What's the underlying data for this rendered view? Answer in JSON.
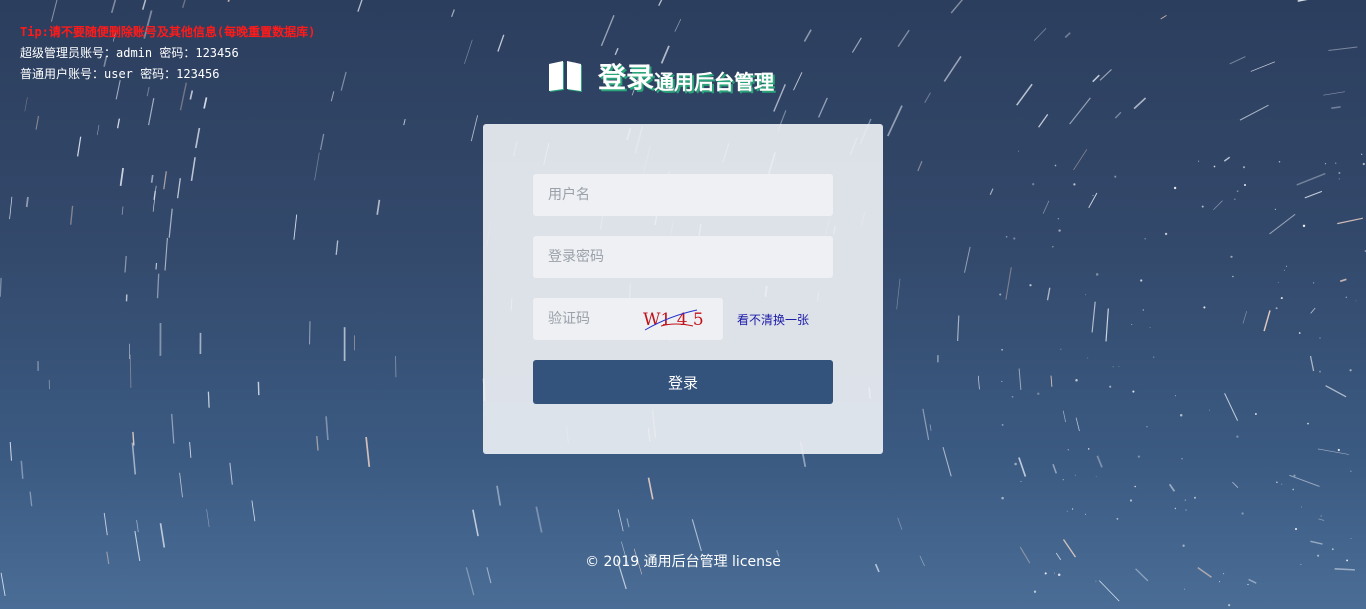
{
  "tips": {
    "warning": "Tip:请不要随便删除账号及其他信息(每晚重置数据库)",
    "admin_account": "超级管理员账号：admin 密码：123456",
    "user_account": "普通用户账号：user 密码：123456"
  },
  "brand": {
    "icon": "open-book-icon",
    "title_main": "登录",
    "title_sub": "通用后台管理",
    "shadow_color": "#2aa57a"
  },
  "login_form": {
    "username_placeholder": "用户名",
    "username_value": "",
    "password_placeholder": "登录密码",
    "password_value": "",
    "captcha_placeholder": "验证码",
    "captcha_value": "",
    "captcha_image_text": "W1 4 5",
    "refresh_captcha_label": "看不清换一张",
    "submit_label": "登录"
  },
  "footer": {
    "copyright": "© 2019 通用后台管理 license"
  },
  "colors": {
    "background": "#33496b",
    "button": "#33527c",
    "warning_text": "#ff1a1a",
    "link_text": "#1a1aa6"
  }
}
